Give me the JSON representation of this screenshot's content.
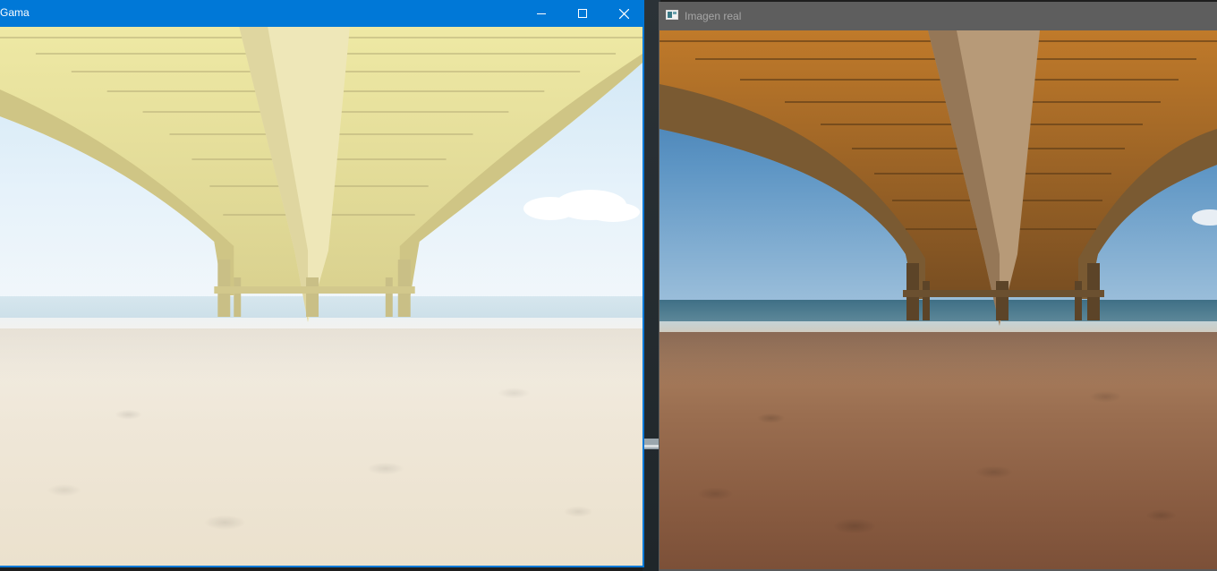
{
  "left_window": {
    "title": "Gama",
    "focused": true,
    "accent_color": "#0078d7",
    "controls": {
      "minimize": "minimize-icon",
      "maximize": "maximize-icon",
      "close": "close-icon"
    },
    "image": {
      "subject": "pier-underside-beach",
      "tone": "gamma-brightened"
    }
  },
  "right_window": {
    "title": "Imagen real",
    "focused": false,
    "titlebar_color": "#5e5e5e",
    "icon": "app-window-icon",
    "image": {
      "subject": "pier-underside-beach",
      "tone": "original"
    }
  }
}
